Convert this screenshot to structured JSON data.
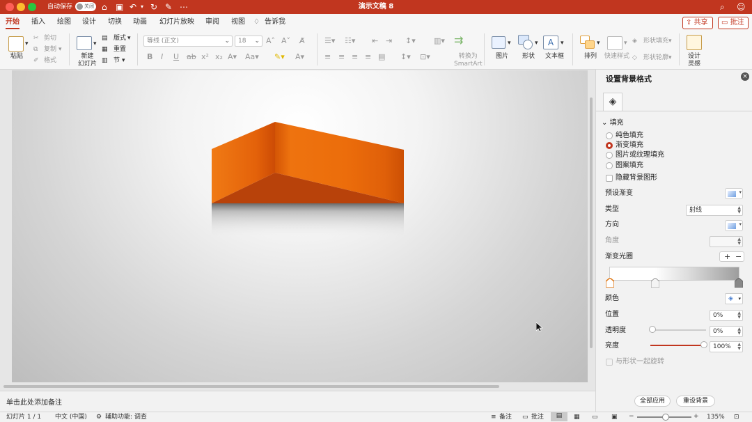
{
  "window": {
    "title": "演示文稿 8",
    "autosave_label": "自动保存",
    "autosave_state": "关闭"
  },
  "tabs": [
    {
      "label": "开始",
      "active": true
    },
    {
      "label": "插入"
    },
    {
      "label": "绘图"
    },
    {
      "label": "设计"
    },
    {
      "label": "切换"
    },
    {
      "label": "动画"
    },
    {
      "label": "幻灯片放映"
    },
    {
      "label": "审阅"
    },
    {
      "label": "视图"
    },
    {
      "label": "告诉我"
    }
  ],
  "actions": {
    "share": "共享",
    "comment": "批注"
  },
  "ribbon": {
    "paste": "粘贴",
    "cut": "剪切",
    "copy": "复制",
    "format": "格式",
    "new_slide": "新建\n幻灯片",
    "layout": "版式",
    "reset": "重置",
    "section": "节",
    "font_name": "等线 (正文)",
    "font_size": "18",
    "convert_smartart": "转换为\nSmartArt",
    "picture": "图片",
    "shape": "形状",
    "textbox": "文本框",
    "arrange": "排列",
    "quick_styles": "快速样式",
    "shape_fill": "形状填充",
    "shape_outline": "形状轮廓",
    "design_ideas": "设计\n灵感"
  },
  "notes_placeholder": "单击此处添加备注",
  "format_pane": {
    "title": "设置背景格式",
    "section_fill": "填充",
    "fill_options": [
      {
        "label": "纯色填充",
        "selected": false
      },
      {
        "label": "渐变填充",
        "selected": true
      },
      {
        "label": "图片或纹理填充",
        "selected": false
      },
      {
        "label": "图案填充",
        "selected": false
      }
    ],
    "hide_bg_graphics": "隐藏背景图形",
    "preset_gradient": "预设渐变",
    "type_label": "类型",
    "type_value": "射线",
    "direction": "方向",
    "angle": "角度",
    "gradient_stops": "渐变光圈",
    "color": "颜色",
    "position_label": "位置",
    "position_value": "0%",
    "transparency_label": "透明度",
    "transparency_value": "0%",
    "brightness_label": "亮度",
    "brightness_value": "100%",
    "rotate_with_shape": "与形状一起旋转",
    "apply_all": "全部应用",
    "reset_bg": "重设背景"
  },
  "status": {
    "slide_info": "幻灯片 1 / 1",
    "language": "中文 (中国)",
    "accessibility": "辅助功能: 调查",
    "notes": "备注",
    "comments": "批注",
    "zoom": "135%"
  },
  "colors": {
    "accent": "#c1361f",
    "shape_orange": "#e8670a",
    "shape_dark": "#b8420a"
  }
}
